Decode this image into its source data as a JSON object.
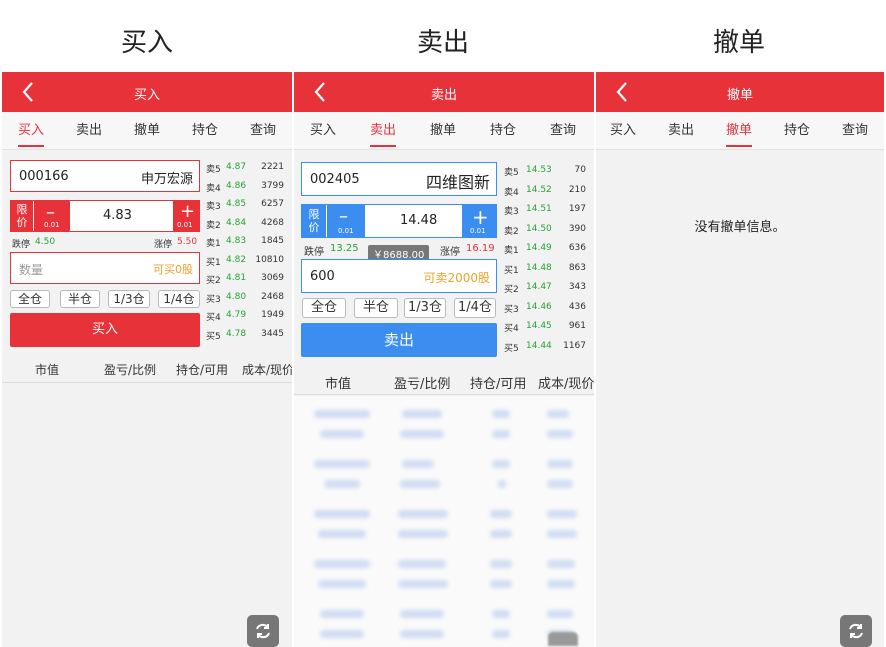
{
  "captions": [
    "买入",
    "卖出",
    "撤单"
  ],
  "tabs": [
    "买入",
    "卖出",
    "撤单",
    "持仓",
    "查询"
  ],
  "buy_panel": {
    "title": "买入",
    "stock_code": "000166",
    "stock_name": "申万宏源",
    "price_mode": "限价",
    "price": "4.83",
    "step": "0.01",
    "limit_down_label": "跌停",
    "limit_down": "4.50",
    "limit_up_label": "涨停",
    "limit_up": "5.50",
    "qty_placeholder": "数量",
    "qty_available": "可买0股",
    "quick": [
      "全仓",
      "半仓",
      "1/3仓",
      "1/4仓"
    ],
    "action": "买入",
    "quotes": [
      {
        "label": "卖5",
        "price": "4.87",
        "vol": "2221"
      },
      {
        "label": "卖4",
        "price": "4.86",
        "vol": "3799"
      },
      {
        "label": "卖3",
        "price": "4.85",
        "vol": "6257"
      },
      {
        "label": "卖2",
        "price": "4.84",
        "vol": "4268"
      },
      {
        "label": "卖1",
        "price": "4.83",
        "vol": "1845"
      },
      {
        "label": "买1",
        "price": "4.82",
        "vol": "10810"
      },
      {
        "label": "买2",
        "price": "4.81",
        "vol": "3069"
      },
      {
        "label": "买3",
        "price": "4.80",
        "vol": "2468"
      },
      {
        "label": "买4",
        "price": "4.79",
        "vol": "1949"
      },
      {
        "label": "买5",
        "price": "4.78",
        "vol": "3445"
      }
    ],
    "columns": [
      "市值",
      "盈亏/比例",
      "持仓/可用",
      "成本/现价"
    ]
  },
  "sell_panel": {
    "title": "卖出",
    "stock_code": "002405",
    "stock_name": "四维图新",
    "price_mode": "限价",
    "price": "14.48",
    "step": "0.01",
    "limit_down_label": "跌停",
    "limit_down": "13.25",
    "limit_up_label": "涨停",
    "limit_up": "16.19",
    "amount_badge": "￥8688.00",
    "qty": "600",
    "qty_available": "可卖2000股",
    "quick": [
      "全仓",
      "半仓",
      "1/3仓",
      "1/4仓"
    ],
    "action": "卖出",
    "quotes": [
      {
        "label": "卖5",
        "price": "14.53",
        "vol": "70"
      },
      {
        "label": "卖4",
        "price": "14.52",
        "vol": "210"
      },
      {
        "label": "卖3",
        "price": "14.51",
        "vol": "197"
      },
      {
        "label": "卖2",
        "price": "14.50",
        "vol": "390"
      },
      {
        "label": "卖1",
        "price": "14.49",
        "vol": "636"
      },
      {
        "label": "买1",
        "price": "14.48",
        "vol": "863"
      },
      {
        "label": "买2",
        "price": "14.47",
        "vol": "343"
      },
      {
        "label": "买3",
        "price": "14.46",
        "vol": "436"
      },
      {
        "label": "买4",
        "price": "14.45",
        "vol": "961"
      },
      {
        "label": "买5",
        "price": "14.44",
        "vol": "1167"
      }
    ],
    "columns": [
      "市值",
      "盈亏/比例",
      "持仓/可用",
      "成本/现价"
    ]
  },
  "cancel_panel": {
    "title": "撤单",
    "empty_message": "没有撤单信息。"
  },
  "colors": {
    "brand_red": "#e8323a",
    "sell_blue": "#3c8df0",
    "price_green": "#26a334"
  }
}
